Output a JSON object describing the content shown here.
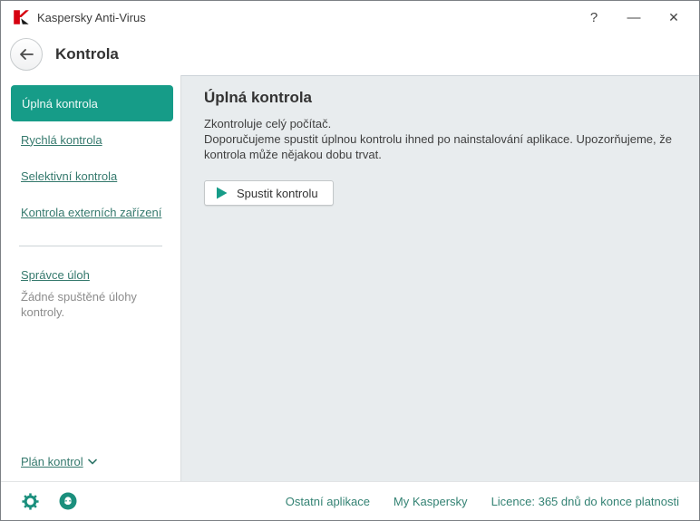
{
  "window": {
    "app_title": "Kaspersky Anti-Virus",
    "controls": {
      "help": "?",
      "minimize": "—",
      "close": "✕"
    }
  },
  "header": {
    "title": "Kontrola",
    "back_icon": "arrow-left-icon"
  },
  "sidebar": {
    "items": [
      {
        "label": "Úplná kontrola",
        "selected": true
      },
      {
        "label": "Rychlá kontrola",
        "selected": false
      },
      {
        "label": "Selektivní kontrola",
        "selected": false
      },
      {
        "label": "Kontrola externích zařízení",
        "selected": false
      }
    ],
    "task_manager_label": "Správce úloh",
    "task_manager_status": "Žádné spuštěné úlohy kontroly.",
    "schedule_label": "Plán kontrol",
    "schedule_icon": "chevron-down-icon"
  },
  "main": {
    "title": "Úplná kontrola",
    "description_line1": "Zkontroluje celý počítač.",
    "description_line2": "Doporučujeme spustit úplnou kontrolu ihned po nainstalování aplikace. Upozorňujeme, že kontrola může nějakou dobu trvat.",
    "start_button_label": "Spustit kontrolu",
    "start_button_icon": "play-icon"
  },
  "footer": {
    "icons": [
      "settings-gear-icon",
      "support-agent-icon"
    ],
    "links": [
      "Ostatní aplikace",
      "My Kaspersky",
      "Licence: 365 dnů do konce platnosti"
    ]
  },
  "colors": {
    "accent": "#169c88",
    "link": "#35796d",
    "footer_link": "#338273",
    "content_bg": "#e8ecee",
    "logo_red": "#d6000f"
  }
}
